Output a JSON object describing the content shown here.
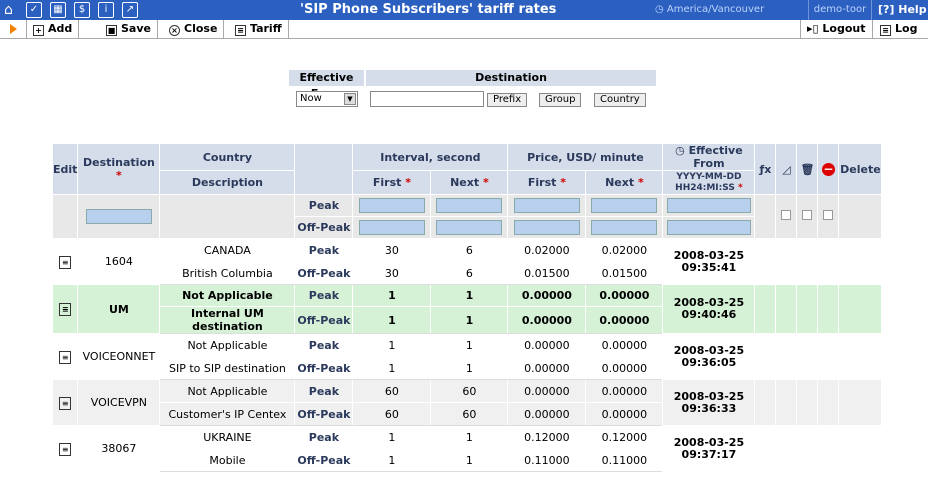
{
  "header": {
    "title": "'SIP Phone Subscribers' tariff rates",
    "timezone": "America/Vancouver",
    "user": "demo-toor",
    "help": "Help"
  },
  "toolbar": {
    "add": "Add",
    "save": "Save",
    "close": "Close",
    "tariff": "Tariff",
    "logout": "Logout",
    "log": "Log"
  },
  "filter": {
    "effective_from_label": "Effective From",
    "destination_label": "Destination",
    "effective_from_value": "Now",
    "prefix_btn": "Prefix",
    "group_btn": "Group",
    "country_btn": "Country"
  },
  "columns": {
    "edit": "Edit",
    "destination": "Destination",
    "required": "*",
    "country": "Country",
    "description": "Description",
    "interval": "Interval, second",
    "price": "Price, USD/ minute",
    "first": "First",
    "next": "Next",
    "effective_from": "Effective From",
    "date_format_1": "YYYY-MM-DD",
    "date_format_2": "HH24:MI:SS",
    "delete": "Delete",
    "peak": "Peak",
    "offpeak": "Off-Peak"
  },
  "rows": [
    {
      "destination": "1604",
      "country": "CANADA",
      "description": "British Columbia",
      "peak": {
        "int_first": "30",
        "int_next": "6",
        "price_first": "0.02000",
        "price_next": "0.02000"
      },
      "offpeak": {
        "int_first": "30",
        "int_next": "6",
        "price_first": "0.01500",
        "price_next": "0.01500"
      },
      "date": "2008-03-25",
      "time": "09:35:41"
    },
    {
      "destination": "UM",
      "country": "Not Applicable",
      "description": "Internal UM destination",
      "peak": {
        "int_first": "1",
        "int_next": "1",
        "price_first": "0.00000",
        "price_next": "0.00000"
      },
      "offpeak": {
        "int_first": "1",
        "int_next": "1",
        "price_first": "0.00000",
        "price_next": "0.00000"
      },
      "date": "2008-03-25",
      "time": "09:40:46"
    },
    {
      "destination": "VOICEONNET",
      "country": "Not Applicable",
      "description": "SIP to SIP destination",
      "peak": {
        "int_first": "1",
        "int_next": "1",
        "price_first": "0.00000",
        "price_next": "0.00000"
      },
      "offpeak": {
        "int_first": "1",
        "int_next": "1",
        "price_first": "0.00000",
        "price_next": "0.00000"
      },
      "date": "2008-03-25",
      "time": "09:36:05"
    },
    {
      "destination": "VOICEVPN",
      "country": "Not Applicable",
      "description": "Customer's IP Centex",
      "peak": {
        "int_first": "60",
        "int_next": "60",
        "price_first": "0.00000",
        "price_next": "0.00000"
      },
      "offpeak": {
        "int_first": "60",
        "int_next": "60",
        "price_first": "0.00000",
        "price_next": "0.00000"
      },
      "date": "2008-03-25",
      "time": "09:36:33"
    },
    {
      "destination": "38067",
      "country": "UKRAINE",
      "description": "Mobile",
      "peak": {
        "int_first": "1",
        "int_next": "1",
        "price_first": "0.12000",
        "price_next": "0.12000"
      },
      "offpeak": {
        "int_first": "1",
        "int_next": "1",
        "price_first": "0.11000",
        "price_next": "0.11000"
      },
      "date": "2008-03-25",
      "time": "09:37:17"
    }
  ],
  "colors": {
    "topbar": "#2c60c0",
    "header_cell": "#d4dde9",
    "highlight_row": "#d6f2d6",
    "input": "#b8d0ee"
  }
}
